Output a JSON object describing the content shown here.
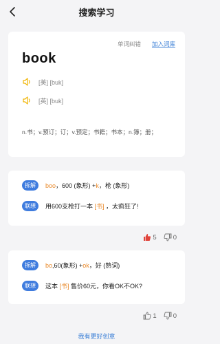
{
  "header": {
    "title": "搜索学习",
    "back_icon": "chevron-left-icon"
  },
  "word_card": {
    "correct_link": "单词纠错",
    "add_link": "加入词库",
    "word": "book",
    "pron_us": "[美] [buk]",
    "pron_uk": "[英] [buk]",
    "meaning": "n.书；v.预订；订；v.预定；书籍；书本；n.簿；册；",
    "accent_color": "#f0b400"
  },
  "memory_cards": [
    {
      "split_label": "拆解",
      "split_parts": [
        {
          "text": "boo",
          "hl": true
        },
        {
          "text": "，600 (象形) +",
          "hl": false
        },
        {
          "text": "k",
          "hl": true
        },
        {
          "text": "，枪 (象形)",
          "hl": false
        }
      ],
      "assoc_label": "联想",
      "assoc_parts": [
        {
          "text": "用600支枪打一本 ",
          "hl": false
        },
        {
          "text": "[书]",
          "hl": true
        },
        {
          "text": " ，太疯狂了!",
          "hl": false
        }
      ],
      "likes": "5",
      "dislikes": "0",
      "liked": true
    },
    {
      "split_label": "拆解",
      "split_parts": [
        {
          "text": "bo",
          "hl": true
        },
        {
          "text": ",60(象形) +",
          "hl": false
        },
        {
          "text": "ok",
          "hl": true
        },
        {
          "text": "，好 (熟词)",
          "hl": false
        }
      ],
      "assoc_label": "联想",
      "assoc_parts": [
        {
          "text": "这本 ",
          "hl": false
        },
        {
          "text": "[书]",
          "hl": true
        },
        {
          "text": " 售价60元，你看OK不OK?",
          "hl": false
        }
      ],
      "likes": "1",
      "dislikes": "0",
      "liked": false
    }
  ],
  "bottom_link": "我有更好创意",
  "colors": {
    "blue": "#3f7cde",
    "orange": "#e98a2b",
    "like_red": "#e0443b"
  }
}
